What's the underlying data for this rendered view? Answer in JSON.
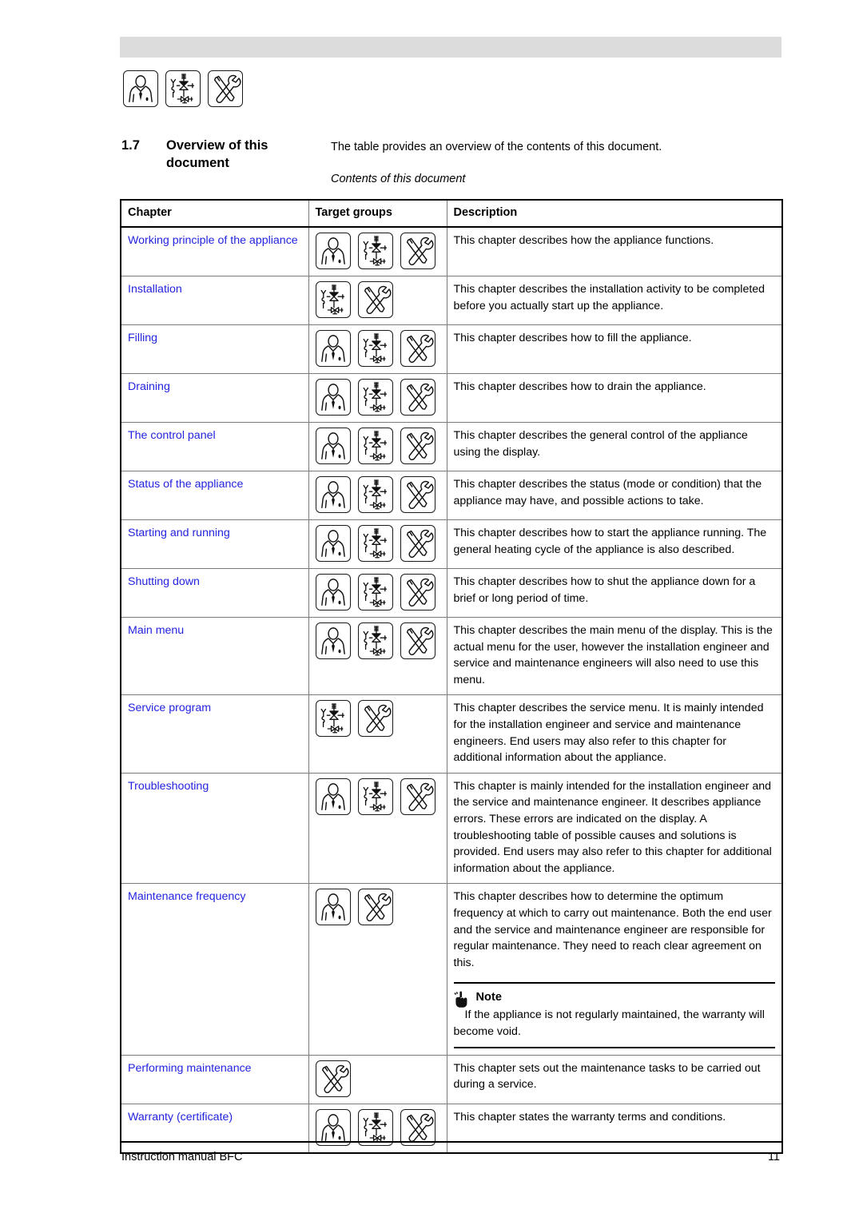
{
  "document": {
    "section_number": "1.7",
    "section_title_line1": "Overview of this",
    "section_title_line2": "document",
    "intro": "The table provides an overview of the contents of this document.",
    "caption": "Contents of this document"
  },
  "target_group_icons": {
    "end_user": "person-in-suit-icon",
    "installation_engineer": "valve-piping-icon",
    "service_engineer": "crossed-tools-icon"
  },
  "header_icons": [
    "person-in-suit-icon",
    "valve-piping-icon",
    "crossed-tools-icon"
  ],
  "table": {
    "headers": [
      "Chapter",
      "Target groups",
      "Description"
    ],
    "rows": [
      {
        "chapter": "Working principle of the appliance",
        "groups": [
          "person",
          "valve",
          "tools"
        ],
        "description": "This chapter describes how the appliance functions."
      },
      {
        "chapter": "Installation",
        "groups": [
          "valve",
          "tools"
        ],
        "description": "This chapter describes the installation activity to be completed before you actually start up the appliance."
      },
      {
        "chapter": "Filling",
        "groups": [
          "person",
          "valve",
          "tools"
        ],
        "description": "This chapter describes how to fill the appliance."
      },
      {
        "chapter": "Draining",
        "groups": [
          "person",
          "valve",
          "tools"
        ],
        "description": "This chapter describes how to drain the appliance."
      },
      {
        "chapter": "The control panel",
        "groups": [
          "person",
          "valve",
          "tools"
        ],
        "description": "This chapter describes the general control of the appliance using the display."
      },
      {
        "chapter": "Status of the appliance",
        "groups": [
          "person",
          "valve",
          "tools"
        ],
        "description": "This chapter describes the status (mode or condition) that the appliance may have, and possible actions to take."
      },
      {
        "chapter": "Starting and running",
        "groups": [
          "person",
          "valve",
          "tools"
        ],
        "description": "This chapter describes how to start the appliance running. The general heating cycle of the appliance is also described."
      },
      {
        "chapter": "Shutting down",
        "groups": [
          "person",
          "valve",
          "tools"
        ],
        "description": "This chapter describes how to shut the appliance down for a brief or long period of time."
      },
      {
        "chapter": "Main menu",
        "groups": [
          "person",
          "valve",
          "tools"
        ],
        "description": "This chapter describes the main menu of the display. This is the actual menu for the user, however the installation engineer and service and maintenance engineers will also need to use this menu."
      },
      {
        "chapter": "Service program",
        "groups": [
          "valve",
          "tools"
        ],
        "description": "This chapter describes the service menu. It is mainly intended for the installation engineer and service and maintenance engineers. End users may also refer to this chapter for additional information about the appliance."
      },
      {
        "chapter": "Troubleshooting",
        "groups": [
          "person",
          "valve",
          "tools"
        ],
        "description": "This chapter is mainly intended for the installation engineer and the service and maintenance engineer. It describes appliance errors. These errors are indicated on the display. A troubleshooting table of possible causes and solutions is provided. End users may also refer to this chapter for additional information about the appliance."
      },
      {
        "chapter": "Maintenance frequency",
        "groups": [
          "person",
          "tools"
        ],
        "description": "This chapter describes how to determine the optimum frequency at which to carry out maintenance. Both the end user and the service and maintenance engineer are responsible for regular maintenance. They need to reach clear agreement on this.",
        "note": {
          "icon": "pointing-hand-icon",
          "title": "Note",
          "body": "If the appliance is not regularly maintained, the warranty will become void."
        }
      },
      {
        "chapter": "Performing maintenance",
        "groups": [
          "tools"
        ],
        "description": "This chapter sets out the maintenance tasks to be carried out during a service."
      },
      {
        "chapter": "Warranty (certificate)",
        "groups": [
          "person",
          "valve",
          "tools"
        ],
        "description": "This chapter states the warranty terms and conditions."
      }
    ]
  },
  "footer": {
    "left": "Instruction manual BFC",
    "page_number": "11"
  },
  "colors": {
    "link": "#2323e0",
    "banner": "#dcdcdc",
    "rule": "#000000",
    "grid": "#7a7a7a"
  }
}
